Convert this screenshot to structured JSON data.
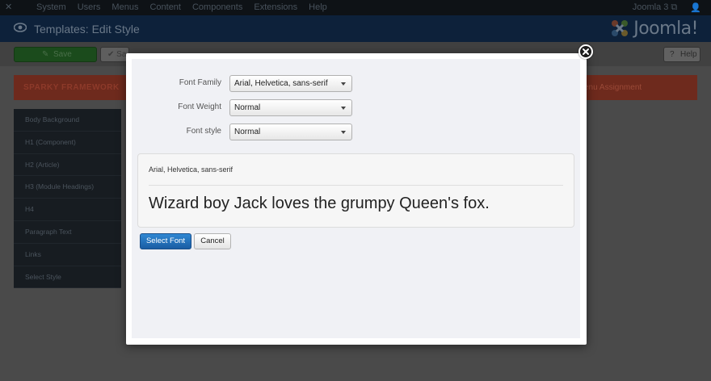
{
  "topbar": {
    "menu": [
      "System",
      "Users",
      "Menus",
      "Content",
      "Components",
      "Extensions",
      "Help"
    ],
    "site_link": "Joomla 3",
    "user_icon": "user-icon"
  },
  "titlebar": {
    "title": "Templates: Edit Style",
    "brand": "Joomla!"
  },
  "toolbar": {
    "save_label": "Save",
    "save_close_label": "Sa",
    "help_label": "Help"
  },
  "background": {
    "framework_label": "SPARKY FRAMEWORK",
    "menu_assignment_label": "enu Assignment",
    "side_items": [
      "Body Background",
      "H1 (Component)",
      "H2 (Article)",
      "H3 (Module Headings)",
      "H4",
      "Paragraph Text",
      "Links",
      "Select Style"
    ]
  },
  "modal": {
    "fields": [
      {
        "label": "Font Family",
        "value": "Arial, Helvetica, sans-serif"
      },
      {
        "label": "Font Weight",
        "value": "Normal"
      },
      {
        "label": "Font style",
        "value": "Normal"
      }
    ],
    "preview": {
      "font_name": "Arial, Helvetica, sans-serif",
      "sample_text": "Wizard boy Jack loves the grumpy Queen's fox."
    },
    "select_button": "Select Font",
    "cancel_button": "Cancel",
    "close_icon": "close-icon"
  },
  "colors": {
    "primary_button": "#2f87d3",
    "banner": "#e6472b",
    "title_bar": "#1a3867",
    "save_button": "#2b8a2d"
  }
}
